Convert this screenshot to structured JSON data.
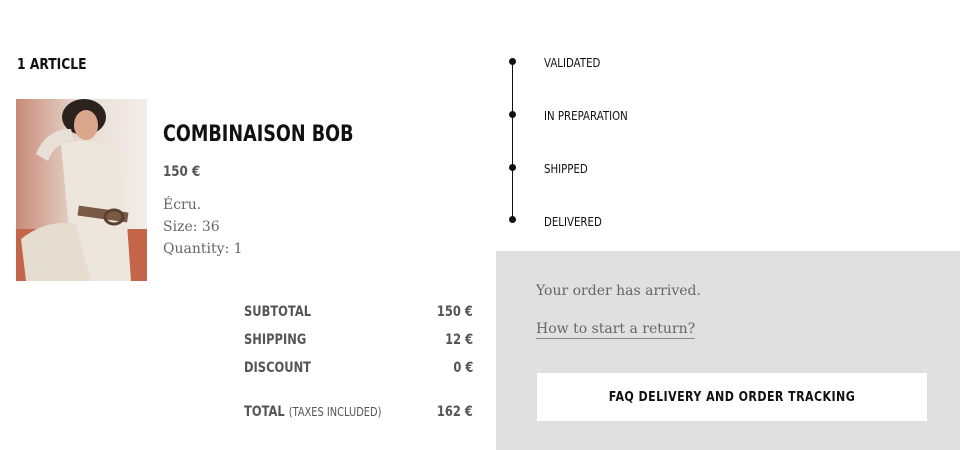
{
  "order": {
    "article_count": "1 ARTICLE"
  },
  "product": {
    "name": "COMBINAISON BOB",
    "price": "150 €",
    "color": "Écru.",
    "size": "Size: 36",
    "quantity": "Quantity: 1"
  },
  "totals": {
    "subtotal_label": "SUBTOTAL",
    "subtotal_value": "150 €",
    "shipping_label": "SHIPPING",
    "shipping_value": "12 €",
    "discount_label": "DISCOUNT",
    "discount_value": "0 €",
    "total_label": "TOTAL",
    "total_note": "(TAXES INCLUDED)",
    "total_value": "162 €"
  },
  "timeline": {
    "steps": [
      {
        "label": "VALIDATED"
      },
      {
        "label": "IN PREPARATION"
      },
      {
        "label": "SHIPPED"
      },
      {
        "label": "DELIVERED"
      }
    ]
  },
  "status_panel": {
    "message": "Your order has arrived.",
    "return_link": "How to start a return?",
    "faq_button": "FAQ DELIVERY AND ORDER TRACKING"
  },
  "colors": {
    "panel_background": "#e0e0e0",
    "text_dark": "#111111",
    "text_muted": "#666666"
  }
}
